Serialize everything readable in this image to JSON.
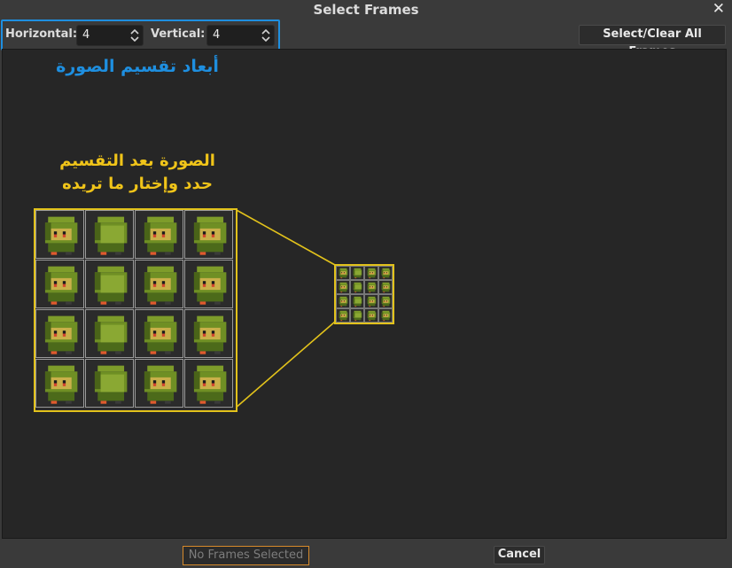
{
  "dialog": {
    "title": "Select Frames"
  },
  "controls": {
    "horizontal_label": "Horizontal:",
    "horizontal_value": "4",
    "vertical_label": "Vertical:",
    "vertical_value": "4",
    "select_clear_label": "Select/Clear All Frames"
  },
  "annotations": {
    "dimensions": "أبعاد تقسيم الصورة",
    "after_split_line1": "الصورة بعد التقسيم",
    "after_split_line2": "حدد وإختار ما تريده"
  },
  "footer": {
    "status": "No Frames Selected",
    "cancel_label": "Cancel"
  },
  "colors": {
    "highlight_blue": "#1e8fe0",
    "highlight_yellow": "#e2c21b",
    "status_border": "#d78a2b"
  },
  "sprite_grid": {
    "rows": 4,
    "columns": 4
  }
}
